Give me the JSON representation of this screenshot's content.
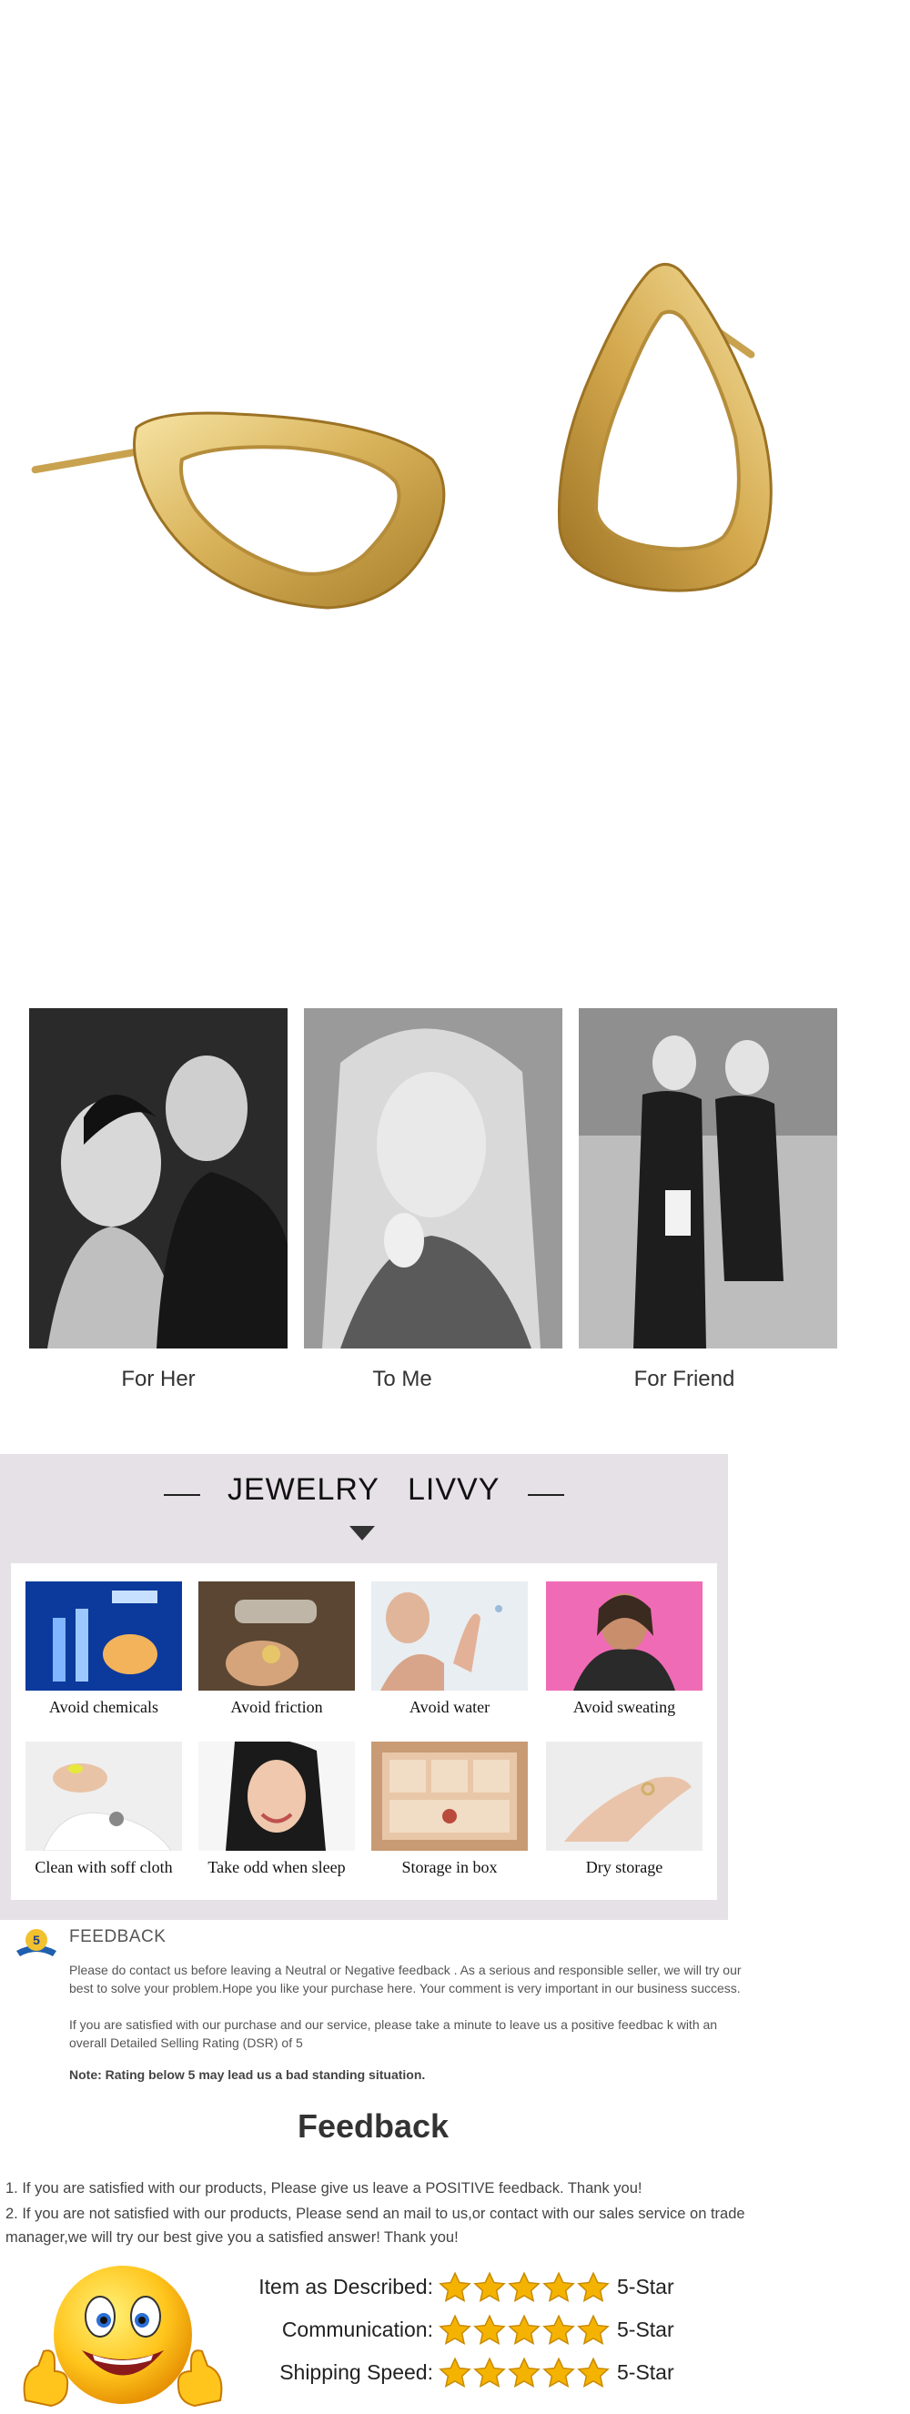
{
  "product": {
    "name": "gold-triangle-stud-earrings",
    "colors": {
      "gold": "#d9b35a",
      "gold_dark": "#a77d2a",
      "gold_light": "#f6e3a3"
    }
  },
  "lifestyle": {
    "captions": [
      "For Her",
      "To Me",
      "For Friend"
    ]
  },
  "care": {
    "brand_left": "JEWELRY",
    "brand_right": "LIVVY",
    "panel_color": "#e6e1e7",
    "items": [
      {
        "label": "Avoid chemicals",
        "icon": "lab-chemicals-image"
      },
      {
        "label": "Avoid friction",
        "icon": "polishing-tool-image"
      },
      {
        "label": "Avoid water",
        "icon": "shower-water-image"
      },
      {
        "label": "Avoid sweating",
        "icon": "sweating-woman-image"
      },
      {
        "label": "Clean with soff cloth",
        "icon": "cloth-cleaning-image"
      },
      {
        "label": "Take odd when sleep",
        "icon": "sleeping-woman-image"
      },
      {
        "label": "Storage in box",
        "icon": "jewelry-box-image"
      },
      {
        "label": "Dry storage",
        "icon": "hand-ring-image"
      }
    ]
  },
  "feedback_notice": {
    "heading": "FEEDBACK",
    "badge_number": "5",
    "para1": "Please do contact us before leaving a Neutral or Negative  feedback . As a serious and responsible seller, we will try our best to solve your problem.Hope you like your purchase here. Your comment is very important in our business success.",
    "para2": " If you are satisfied with our purchase and our service,  please take a minute to leave us  a positive feedbac k with an overall  Detailed Selling Rating (DSR) of 5",
    "note": "Note: Rating below 5 may lead us a bad standing situation."
  },
  "feedback": {
    "title": "Feedback",
    "line1": "1. If you are satisfied with our products, Please give us leave a POSITIVE feedback. Thank you!",
    "line2": "2. If you are not satisfied with our products, Please send an mail to us,or contact with our sales service on trade manager,we will try our best give you a satisfied answer! Thank you!",
    "ratings": [
      {
        "label": "Item as Described:",
        "stars": 5,
        "value": "5-Star"
      },
      {
        "label": "Communication:",
        "stars": 5,
        "value": "5-Star"
      },
      {
        "label": "Shipping Speed:",
        "stars": 5,
        "value": "5-Star"
      }
    ],
    "star_color": "#f5b301",
    "emoji_icon": "thumbs-up-smiley-icon"
  }
}
